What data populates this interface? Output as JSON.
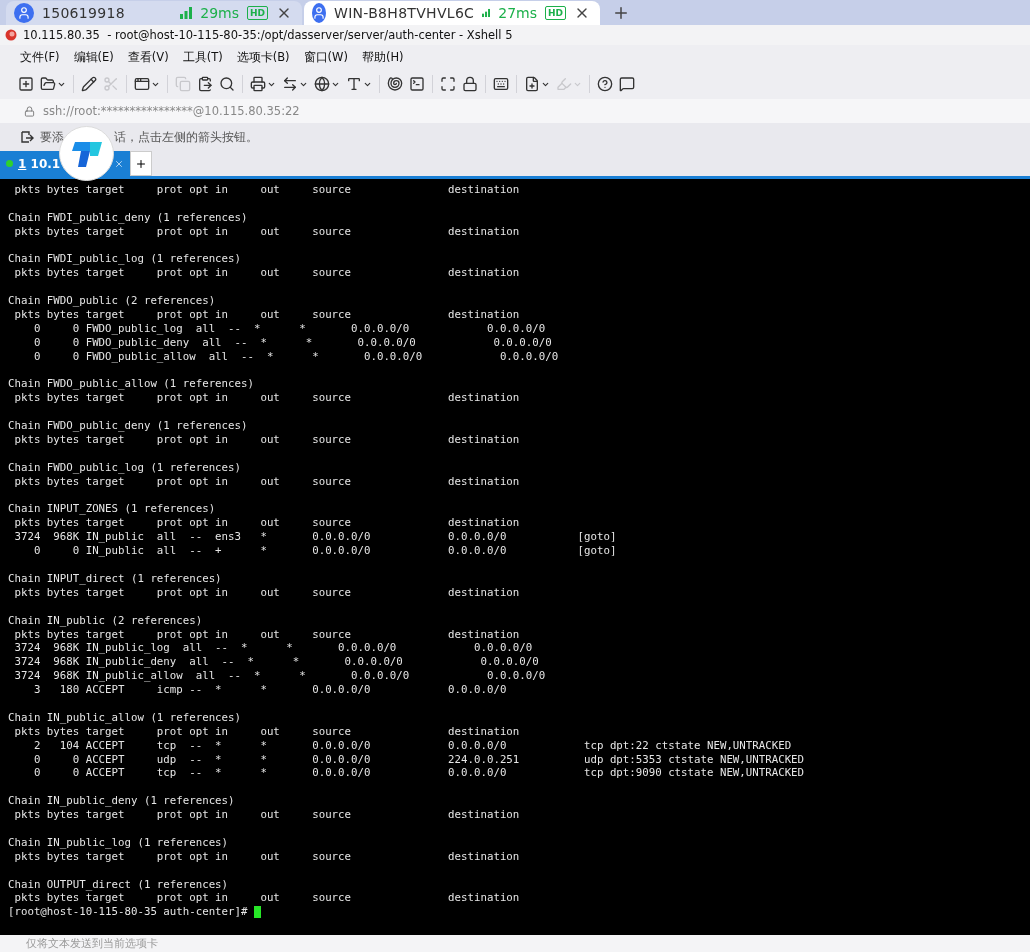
{
  "remote_tabs": [
    {
      "title": "150619918",
      "latency": "29ms",
      "quality": "HD",
      "selected": false
    },
    {
      "title": "WIN-B8H8TVHVL6C",
      "latency": "27ms",
      "quality": "HD",
      "selected": true
    }
  ],
  "window": {
    "title": "10.115.80.35  - root@host-10-115-80-35:/opt/dasserver/server/auth-center - Xshell 5"
  },
  "menu": [
    "文件(F)",
    "编辑(E)",
    "查看(V)",
    "工具(T)",
    "选项卡(B)",
    "窗口(W)",
    "帮助(H)"
  ],
  "toolbar": [
    [
      {
        "dropdown": false,
        "disabled": false
      },
      {
        "dropdown": true,
        "disabled": false
      }
    ],
    [
      {
        "dropdown": false,
        "disabled": false
      },
      {
        "dropdown": false,
        "disabled": true
      }
    ],
    [
      {
        "dropdown": true,
        "disabled": false
      }
    ],
    [
      {
        "dropdown": false,
        "disabled": true
      },
      {
        "dropdown": false,
        "disabled": false
      },
      {
        "dropdown": false,
        "disabled": false
      }
    ],
    [
      {
        "dropdown": true,
        "disabled": false
      },
      {
        "dropdown": true,
        "disabled": false
      },
      {
        "dropdown": true,
        "disabled": false
      },
      {
        "dropdown": true,
        "disabled": false
      }
    ],
    [
      {
        "dropdown": false,
        "disabled": false
      },
      {
        "dropdown": false,
        "disabled": false
      }
    ],
    [
      {
        "dropdown": false,
        "disabled": false
      },
      {
        "dropdown": false,
        "disabled": false
      }
    ],
    [
      {
        "dropdown": false,
        "disabled": false
      }
    ],
    [
      {
        "dropdown": true,
        "disabled": false
      },
      {
        "dropdown": true,
        "disabled": true
      }
    ],
    [
      {
        "dropdown": false,
        "disabled": false
      },
      {
        "dropdown": false,
        "disabled": false
      }
    ]
  ],
  "address": "ssh://root:****************@10.115.80.35:22",
  "hint": [
    "要添",
    "话，点击左侧的箭头按钮。"
  ],
  "session_tabs": [
    {
      "number": "1",
      "label": "10.1",
      "connected": true,
      "selected": true
    }
  ],
  "terminal": {
    "blocks": [
      {
        "lines": [
          " pkts bytes target     prot opt in     out     source               destination"
        ]
      },
      {
        "lines": [
          "Chain FWDI_public_deny (1 references)",
          " pkts bytes target     prot opt in     out     source               destination"
        ]
      },
      {
        "lines": [
          "Chain FWDI_public_log (1 references)",
          " pkts bytes target     prot opt in     out     source               destination"
        ]
      },
      {
        "lines": [
          "Chain FWDO_public (2 references)",
          " pkts bytes target     prot opt in     out     source               destination",
          "    0     0 FWDO_public_log  all  --  *      *       0.0.0.0/0            0.0.0.0/0",
          "    0     0 FWDO_public_deny  all  --  *      *       0.0.0.0/0            0.0.0.0/0",
          "    0     0 FWDO_public_allow  all  --  *      *       0.0.0.0/0            0.0.0.0/0"
        ]
      },
      {
        "lines": [
          "Chain FWDO_public_allow (1 references)",
          " pkts bytes target     prot opt in     out     source               destination"
        ]
      },
      {
        "lines": [
          "Chain FWDO_public_deny (1 references)",
          " pkts bytes target     prot opt in     out     source               destination"
        ]
      },
      {
        "lines": [
          "Chain FWDO_public_log (1 references)",
          " pkts bytes target     prot opt in     out     source               destination"
        ]
      },
      {
        "lines": [
          "Chain INPUT_ZONES (1 references)",
          " pkts bytes target     prot opt in     out     source               destination",
          " 3724  968K IN_public  all  --  ens3   *       0.0.0.0/0            0.0.0.0/0           [goto]",
          "    0     0 IN_public  all  --  +      *       0.0.0.0/0            0.0.0.0/0           [goto]"
        ]
      },
      {
        "lines": [
          "Chain INPUT_direct (1 references)",
          " pkts bytes target     prot opt in     out     source               destination"
        ]
      },
      {
        "lines": [
          "Chain IN_public (2 references)",
          " pkts bytes target     prot opt in     out     source               destination",
          " 3724  968K IN_public_log  all  --  *      *       0.0.0.0/0            0.0.0.0/0",
          " 3724  968K IN_public_deny  all  --  *      *       0.0.0.0/0            0.0.0.0/0",
          " 3724  968K IN_public_allow  all  --  *      *       0.0.0.0/0            0.0.0.0/0",
          "    3   180 ACCEPT     icmp --  *      *       0.0.0.0/0            0.0.0.0/0"
        ]
      },
      {
        "lines": [
          "Chain IN_public_allow (1 references)",
          " pkts bytes target     prot opt in     out     source               destination",
          "    2   104 ACCEPT     tcp  --  *      *       0.0.0.0/0            0.0.0.0/0            tcp dpt:22 ctstate NEW,UNTRACKED",
          "    0     0 ACCEPT     udp  --  *      *       0.0.0.0/0            224.0.0.251          udp dpt:5353 ctstate NEW,UNTRACKED",
          "    0     0 ACCEPT     tcp  --  *      *       0.0.0.0/0            0.0.0.0/0            tcp dpt:9090 ctstate NEW,UNTRACKED"
        ]
      },
      {
        "lines": [
          "Chain IN_public_deny (1 references)",
          " pkts bytes target     prot opt in     out     source               destination"
        ]
      },
      {
        "lines": [
          "Chain IN_public_log (1 references)",
          " pkts bytes target     prot opt in     out     source               destination"
        ]
      },
      {
        "lines": [
          "Chain OUTPUT_direct (1 references)",
          " pkts bytes target     prot opt in     out     source               destination"
        ],
        "prompt": "[root@host-10-115-80-35 auth-center]# "
      }
    ]
  },
  "compose_bar": {
    "placeholder": "仅将文本发送到当前选项卡"
  }
}
